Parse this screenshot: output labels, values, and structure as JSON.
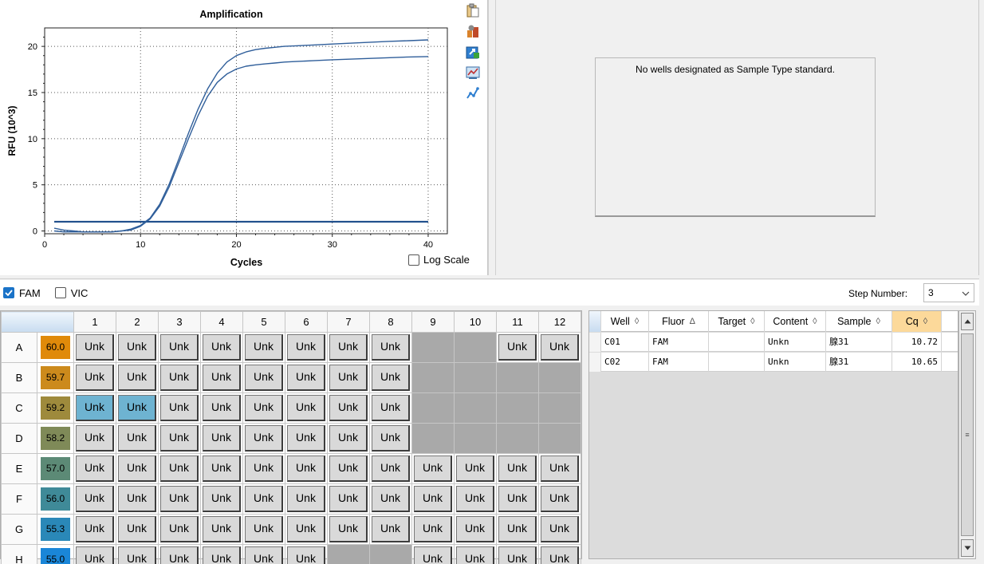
{
  "colors": {
    "curve": "#2f5e9a",
    "threshold": "#1f4e8c",
    "selected_well": "#6eb3d1",
    "empty_well": "#a9a9a9",
    "sorted_header": "#fcd99a",
    "checkbox_blue": "#1a73c8"
  },
  "chart": {
    "log_scale_label": "Log Scale",
    "log_scale_checked": false,
    "tools": [
      "copy-icon",
      "settings-icon",
      "export-icon",
      "chart-options-icon",
      "trace-icon"
    ]
  },
  "chart_data": {
    "type": "line",
    "title": "Amplification",
    "xlabel": "Cycles",
    "ylabel": "RFU (10^3)",
    "xlim": [
      0,
      42
    ],
    "ylim": [
      -0.3,
      22
    ],
    "x_ticks": [
      0,
      10,
      20,
      30,
      40
    ],
    "y_ticks": [
      0,
      5,
      10,
      15,
      20
    ],
    "grid": "dotted",
    "threshold": 1.0,
    "series": [
      {
        "x": [
          1,
          2,
          3,
          4,
          5,
          6,
          7,
          8,
          9,
          10,
          11,
          12,
          13,
          14,
          15,
          16,
          17,
          18,
          19,
          20,
          21,
          22,
          23,
          24,
          25,
          26,
          28,
          30,
          32,
          34,
          36,
          38,
          40
        ],
        "values": [
          0.3,
          0.1,
          0.0,
          -0.1,
          -0.1,
          -0.1,
          -0.1,
          0.0,
          0.2,
          0.6,
          1.4,
          2.9,
          5.1,
          7.8,
          10.6,
          13.2,
          15.4,
          17.1,
          18.3,
          19.0,
          19.4,
          19.65,
          19.8,
          19.9,
          20.0,
          20.05,
          20.15,
          20.25,
          20.35,
          20.45,
          20.55,
          20.62,
          20.7
        ]
      },
      {
        "x": [
          1,
          2,
          3,
          4,
          5,
          6,
          7,
          8,
          9,
          10,
          11,
          12,
          13,
          14,
          15,
          16,
          17,
          18,
          19,
          20,
          21,
          22,
          23,
          24,
          25,
          26,
          28,
          30,
          32,
          34,
          36,
          38,
          40
        ],
        "values": [
          0.0,
          -0.1,
          -0.1,
          -0.1,
          -0.1,
          -0.1,
          -0.1,
          0.0,
          0.1,
          0.5,
          1.3,
          2.7,
          4.8,
          7.4,
          10.0,
          12.5,
          14.6,
          16.1,
          17.0,
          17.55,
          17.85,
          18.0,
          18.1,
          18.2,
          18.3,
          18.35,
          18.45,
          18.55,
          18.62,
          18.7,
          18.78,
          18.85,
          18.9
        ]
      }
    ]
  },
  "std_panel": {
    "message": "No wells designated as Sample Type standard."
  },
  "fluors": [
    {
      "name": "FAM",
      "checked": true
    },
    {
      "name": "VIC",
      "checked": false
    }
  ],
  "step": {
    "label": "Step Number:",
    "value": "3"
  },
  "plate": {
    "columns": [
      "1",
      "2",
      "3",
      "4",
      "5",
      "6",
      "7",
      "8",
      "9",
      "10",
      "11",
      "12"
    ],
    "rows": [
      {
        "label": "A",
        "temp": "60.0",
        "temp_color": "#e08a0a",
        "wells": [
          "Unk",
          "Unk",
          "Unk",
          "Unk",
          "Unk",
          "Unk",
          "Unk",
          "Unk",
          "",
          "",
          "Unk",
          "Unk"
        ]
      },
      {
        "label": "B",
        "temp": "59.7",
        "temp_color": "#cc8a1c",
        "wells": [
          "Unk",
          "Unk",
          "Unk",
          "Unk",
          "Unk",
          "Unk",
          "Unk",
          "Unk",
          "",
          "",
          "",
          ""
        ]
      },
      {
        "label": "C",
        "temp": "59.2",
        "temp_color": "#9e8a3c",
        "wells": [
          "Unk",
          "Unk",
          "Unk",
          "Unk",
          "Unk",
          "Unk",
          "Unk",
          "Unk",
          "",
          "",
          "",
          ""
        ]
      },
      {
        "label": "D",
        "temp": "58.2",
        "temp_color": "#7f8a58",
        "wells": [
          "Unk",
          "Unk",
          "Unk",
          "Unk",
          "Unk",
          "Unk",
          "Unk",
          "Unk",
          "",
          "",
          "",
          ""
        ]
      },
      {
        "label": "E",
        "temp": "57.0",
        "temp_color": "#5c8a76",
        "wells": [
          "Unk",
          "Unk",
          "Unk",
          "Unk",
          "Unk",
          "Unk",
          "Unk",
          "Unk",
          "Unk",
          "Unk",
          "Unk",
          "Unk"
        ]
      },
      {
        "label": "F",
        "temp": "56.0",
        "temp_color": "#3f8a98",
        "wells": [
          "Unk",
          "Unk",
          "Unk",
          "Unk",
          "Unk",
          "Unk",
          "Unk",
          "Unk",
          "Unk",
          "Unk",
          "Unk",
          "Unk"
        ]
      },
      {
        "label": "G",
        "temp": "55.3",
        "temp_color": "#2a88b8",
        "wells": [
          "Unk",
          "Unk",
          "Unk",
          "Unk",
          "Unk",
          "Unk",
          "Unk",
          "Unk",
          "Unk",
          "Unk",
          "Unk",
          "Unk"
        ]
      },
      {
        "label": "H",
        "temp": "55.0",
        "temp_color": "#1a86d8",
        "wells": [
          "Unk",
          "Unk",
          "Unk",
          "Unk",
          "Unk",
          "Unk",
          "",
          "",
          "Unk",
          "Unk",
          "Unk",
          "Unk"
        ]
      }
    ],
    "selected_wells": [
      "C1",
      "C2"
    ]
  },
  "results": {
    "headers": [
      {
        "label": "Well",
        "sort": "◊"
      },
      {
        "label": "Fluor",
        "sort": "Δ"
      },
      {
        "label": "Target",
        "sort": "◊"
      },
      {
        "label": "Content",
        "sort": "◊"
      },
      {
        "label": "Sample",
        "sort": "◊"
      },
      {
        "label": "Cq",
        "sort": "◊"
      }
    ],
    "rows": [
      {
        "well": "C01",
        "fluor": "FAM",
        "target": "",
        "content": "Unkn",
        "sample": "腺31",
        "cq": "10.72"
      },
      {
        "well": "C02",
        "fluor": "FAM",
        "target": "",
        "content": "Unkn",
        "sample": "腺31",
        "cq": "10.65"
      }
    ]
  }
}
